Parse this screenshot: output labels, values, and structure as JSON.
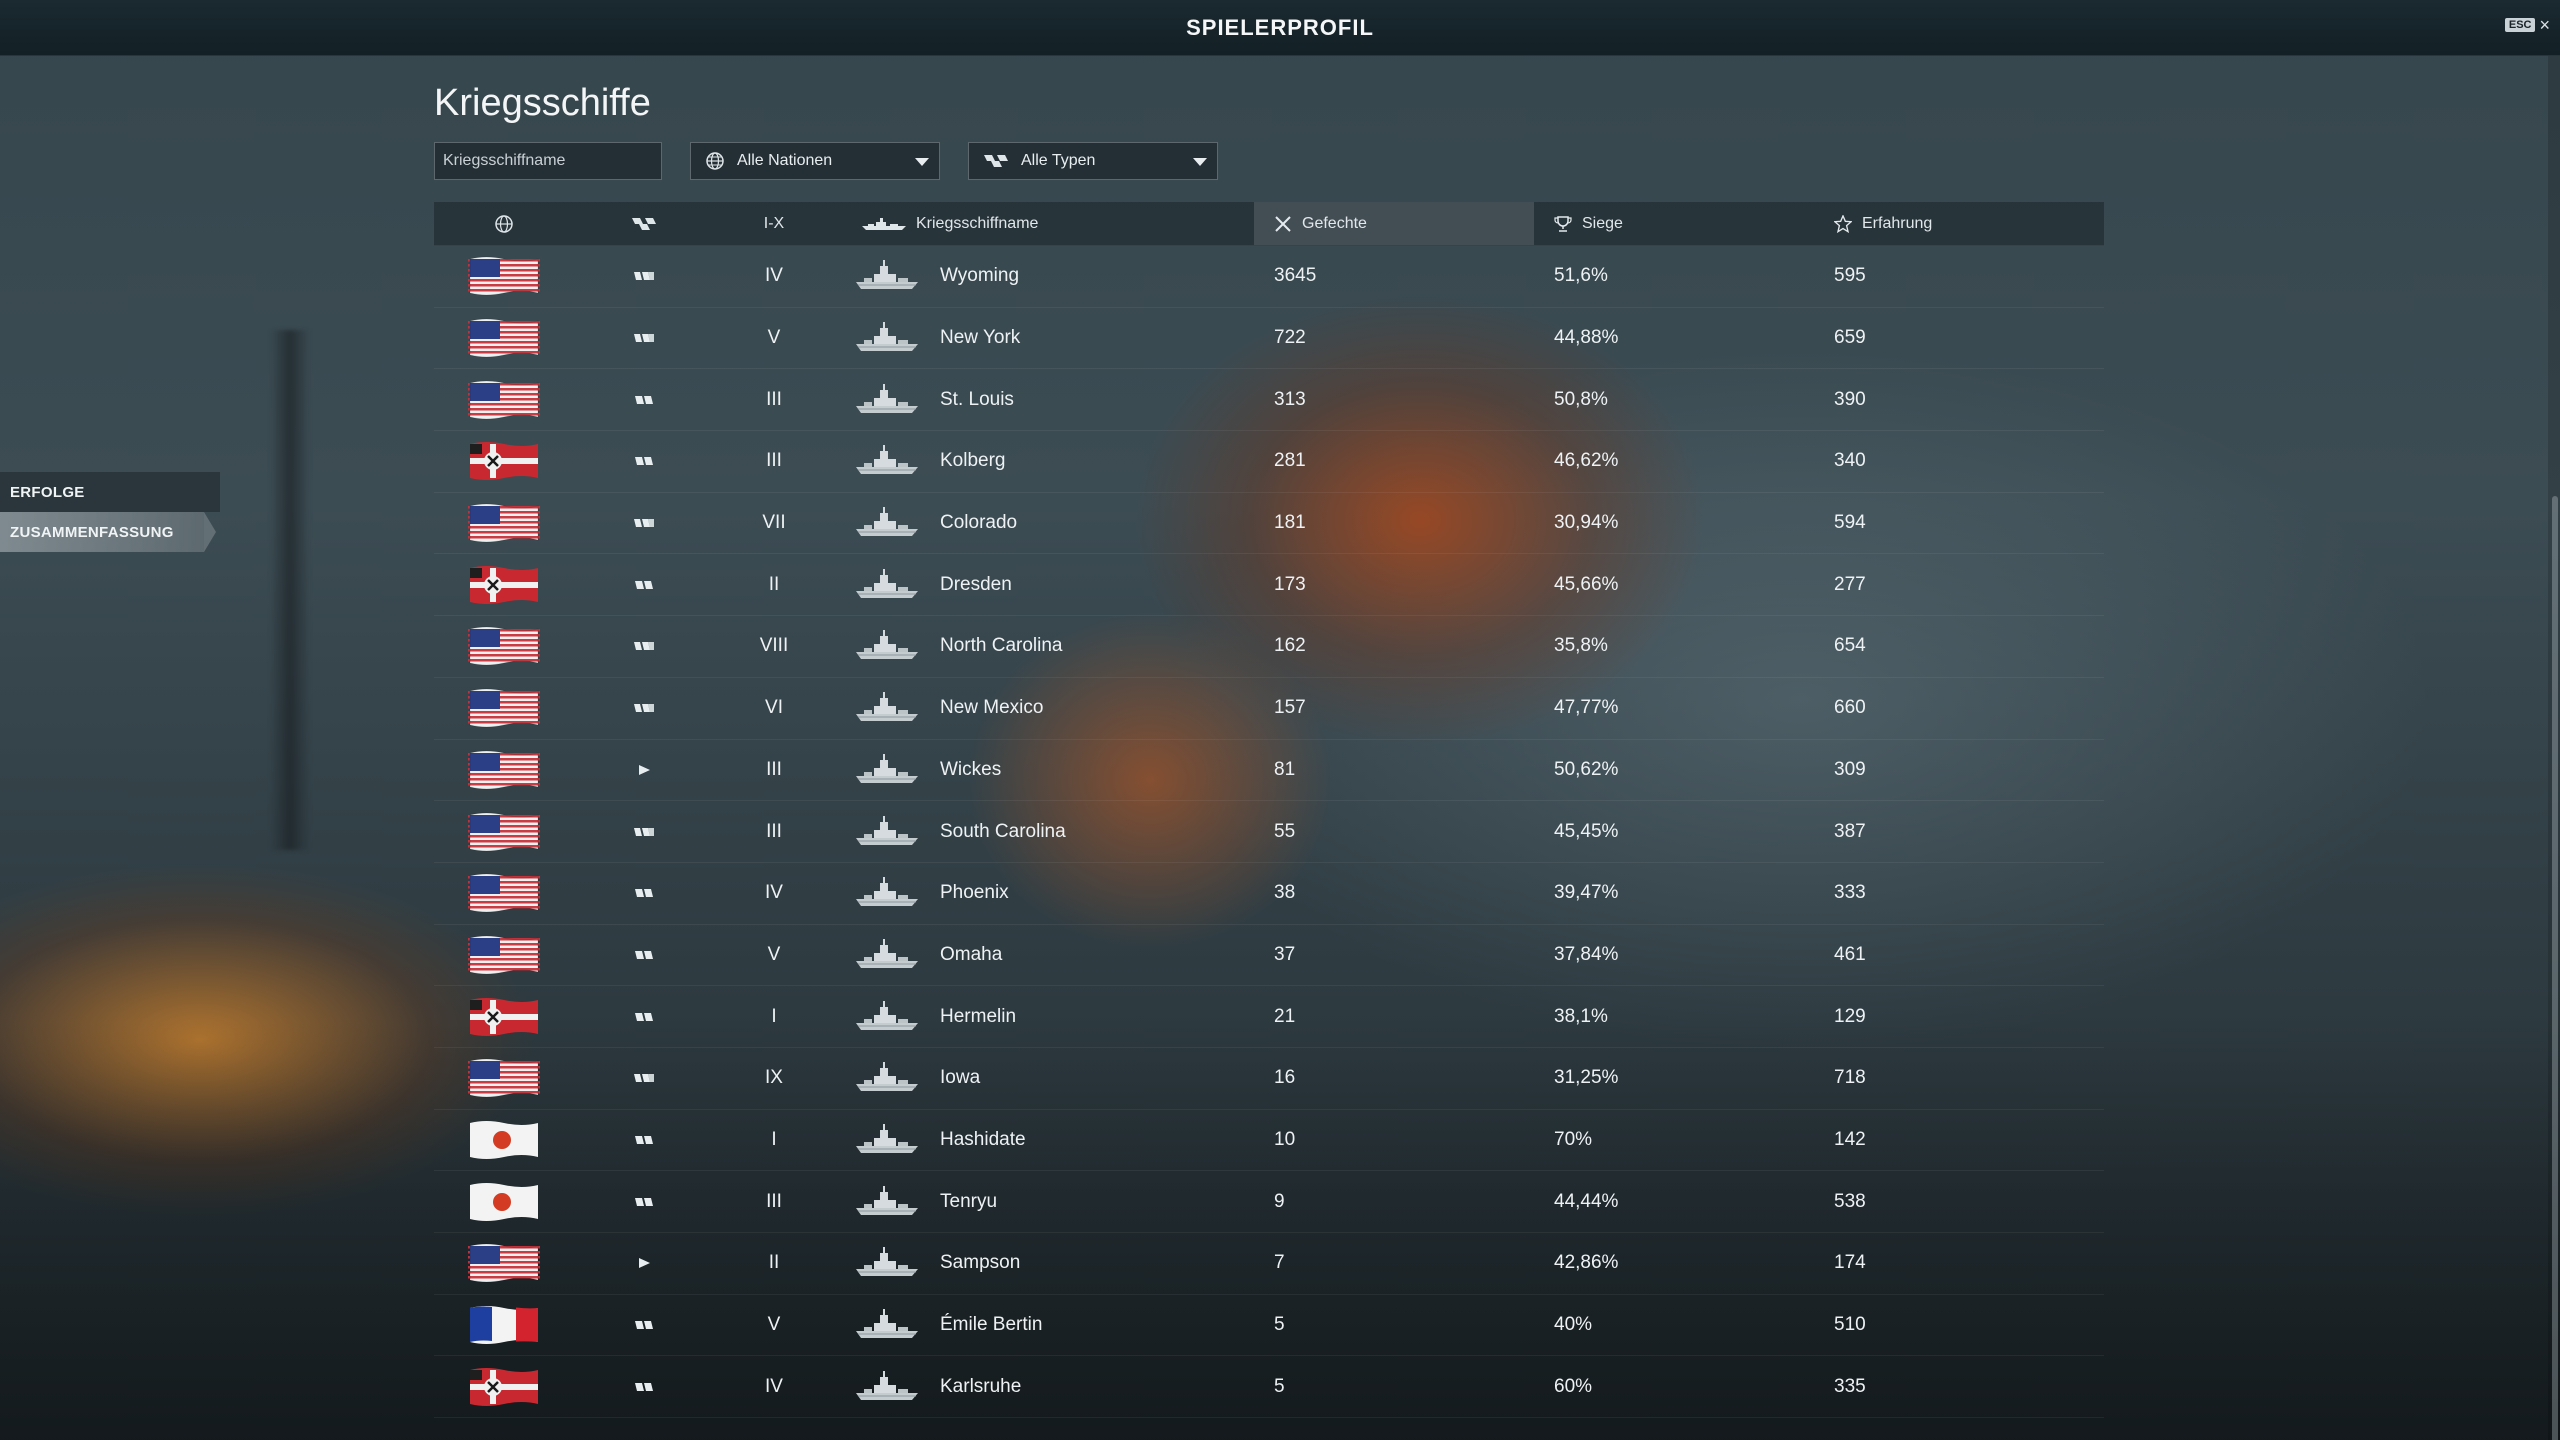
{
  "header": {
    "title": "SPIELERPROFIL",
    "esc_label": "ESC",
    "close_glyph": "×"
  },
  "sidenav": {
    "items": [
      {
        "label": "ERFOLGE"
      },
      {
        "label": "ZUSAMMENFASSUNG"
      }
    ]
  },
  "page": {
    "title": "Kriegsschiffe"
  },
  "filters": {
    "search_placeholder": "Kriegsschiffname",
    "nation_dropdown": "Alle Nationen",
    "type_dropdown": "Alle Typen"
  },
  "table": {
    "headers": {
      "nation_icon": "globe-icon",
      "type_icon": "ship-type-icon",
      "tier": "I-X",
      "name": "Kriegsschiffname",
      "battles": "Gefechte",
      "wins": "Siege",
      "xp": "Erfahrung"
    },
    "rows": [
      {
        "nation": "usa",
        "type": "battleship",
        "tier": "IV",
        "name": "Wyoming",
        "battles": "3645",
        "wins": "51,6%",
        "xp": "595"
      },
      {
        "nation": "usa",
        "type": "battleship",
        "tier": "V",
        "name": "New York",
        "battles": "722",
        "wins": "44,88%",
        "xp": "659"
      },
      {
        "nation": "usa",
        "type": "cruiser",
        "tier": "III",
        "name": "St. Louis",
        "battles": "313",
        "wins": "50,8%",
        "xp": "390"
      },
      {
        "nation": "germany",
        "type": "cruiser",
        "tier": "III",
        "name": "Kolberg",
        "battles": "281",
        "wins": "46,62%",
        "xp": "340"
      },
      {
        "nation": "usa",
        "type": "battleship",
        "tier": "VII",
        "name": "Colorado",
        "battles": "181",
        "wins": "30,94%",
        "xp": "594"
      },
      {
        "nation": "germany",
        "type": "cruiser",
        "tier": "II",
        "name": "Dresden",
        "battles": "173",
        "wins": "45,66%",
        "xp": "277"
      },
      {
        "nation": "usa",
        "type": "battleship",
        "tier": "VIII",
        "name": "North Carolina",
        "battles": "162",
        "wins": "35,8%",
        "xp": "654"
      },
      {
        "nation": "usa",
        "type": "battleship",
        "tier": "VI",
        "name": "New Mexico",
        "battles": "157",
        "wins": "47,77%",
        "xp": "660"
      },
      {
        "nation": "usa",
        "type": "destroyer",
        "tier": "III",
        "name": "Wickes",
        "battles": "81",
        "wins": "50,62%",
        "xp": "309"
      },
      {
        "nation": "usa",
        "type": "battleship",
        "tier": "III",
        "name": "South Carolina",
        "battles": "55",
        "wins": "45,45%",
        "xp": "387"
      },
      {
        "nation": "usa",
        "type": "cruiser",
        "tier": "IV",
        "name": "Phoenix",
        "battles": "38",
        "wins": "39,47%",
        "xp": "333"
      },
      {
        "nation": "usa",
        "type": "cruiser",
        "tier": "V",
        "name": "Omaha",
        "battles": "37",
        "wins": "37,84%",
        "xp": "461"
      },
      {
        "nation": "germany",
        "type": "cruiser",
        "tier": "I",
        "name": "Hermelin",
        "battles": "21",
        "wins": "38,1%",
        "xp": "129"
      },
      {
        "nation": "usa",
        "type": "battleship",
        "tier": "IX",
        "name": "Iowa",
        "battles": "16",
        "wins": "31,25%",
        "xp": "718"
      },
      {
        "nation": "japan",
        "type": "cruiser",
        "tier": "I",
        "name": "Hashidate",
        "battles": "10",
        "wins": "70%",
        "xp": "142"
      },
      {
        "nation": "japan",
        "type": "cruiser",
        "tier": "III",
        "name": "Tenryu",
        "battles": "9",
        "wins": "44,44%",
        "xp": "538"
      },
      {
        "nation": "usa",
        "type": "destroyer",
        "tier": "II",
        "name": "Sampson",
        "battles": "7",
        "wins": "42,86%",
        "xp": "174"
      },
      {
        "nation": "france",
        "type": "cruiser",
        "tier": "V",
        "name": "Émile Bertin",
        "battles": "5",
        "wins": "40%",
        "xp": "510"
      },
      {
        "nation": "germany",
        "type": "cruiser",
        "tier": "IV",
        "name": "Karlsruhe",
        "battles": "5",
        "wins": "60%",
        "xp": "335"
      }
    ]
  }
}
